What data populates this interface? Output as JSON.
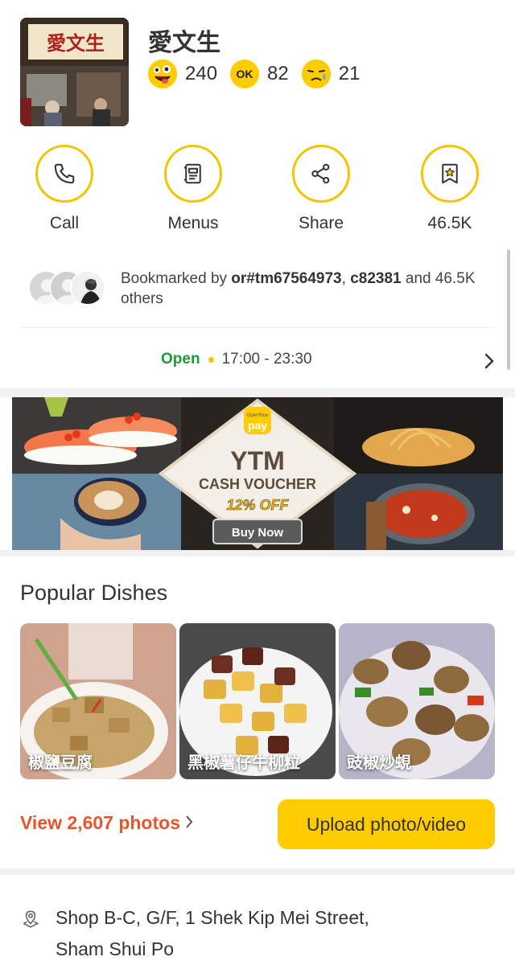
{
  "restaurant": {
    "name": "愛文生",
    "thumbnail_sign_text": "愛文生",
    "ratings": [
      {
        "icon": "smile-face-icon",
        "count": "240"
      },
      {
        "icon": "ok-face-icon",
        "label": "OK",
        "count": "82"
      },
      {
        "icon": "sad-face-icon",
        "count": "21"
      }
    ]
  },
  "actions": {
    "call": "Call",
    "menus": "Menus",
    "share": "Share",
    "bookmark_count": "46.5K"
  },
  "bookmarked": {
    "prefix": "Bookmarked by ",
    "user1": "or#tm67564973",
    "sep": ", ",
    "user2": "c82381",
    "suffix": " and 46.5K others"
  },
  "open": {
    "status": "Open",
    "hours": "17:00 - 23:30"
  },
  "banner": {
    "brand_top": "OpenRice",
    "brand": "pay",
    "headline": "YTM",
    "subheadline": "CASH VOUCHER",
    "discount": "12% OFF",
    "cta": "Buy Now"
  },
  "popular": {
    "title": "Popular Dishes",
    "dishes": [
      {
        "name": "椒鹽豆腐"
      },
      {
        "name": "黑椒薯仔牛柳粒"
      },
      {
        "name": "豉椒炒蜆"
      }
    ],
    "view_photos": "View 2,607 photos",
    "upload": "Upload photo/video"
  },
  "address": {
    "text": "Shop B-C, G/F, 1 Shek Kip Mei Street, Sham Shui Po"
  },
  "colors": {
    "accent": "#ffcc00",
    "open_green": "#1a9a3a",
    "link_orange": "#e8542c"
  }
}
